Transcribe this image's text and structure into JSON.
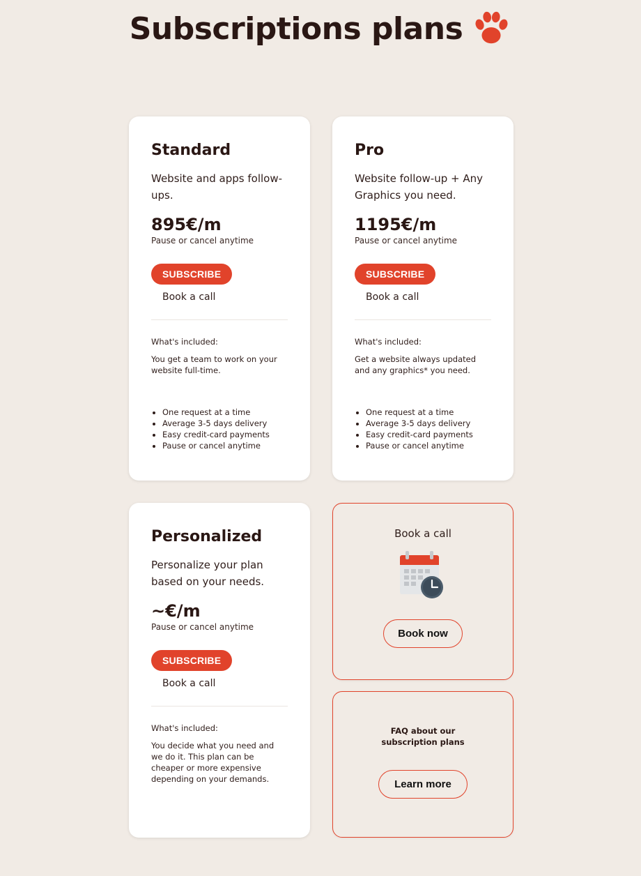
{
  "header": {
    "title": "Subscriptions plans",
    "icon": "paw-icon",
    "accent_color": "#e1432b"
  },
  "plans": [
    {
      "name": "Standard",
      "description": "Website and apps follow-ups.",
      "price": "895€/m",
      "price_note": "Pause or cancel anytime",
      "subscribe_label": "SUBSCRIBE",
      "call_label": "Book a call",
      "included_label": "What's included:",
      "included_text": "You get a team to work on your website full-time.",
      "features": [
        "One request at a time",
        "Average 3-5 days delivery",
        "Easy credit-card payments",
        "Pause or cancel anytime"
      ]
    },
    {
      "name": "Pro",
      "description": "Website follow-up + Any Graphics you need.",
      "price": "1195€/m",
      "price_note": "Pause or cancel anytime",
      "subscribe_label": "SUBSCRIBE",
      "call_label": "Book a call",
      "included_label": "What's included:",
      "included_text": "Get a website always updated and any graphics* you need.",
      "features": [
        "One request at a time",
        "Average 3-5 days delivery",
        "Easy credit-card payments",
        "Pause or cancel anytime"
      ]
    },
    {
      "name": "Personalized",
      "description": "Personalize your plan based on your needs.",
      "price": "~€/m",
      "price_note": "Pause or cancel anytime",
      "subscribe_label": "SUBSCRIBE",
      "call_label": "Book a call",
      "included_label": "What's included:",
      "included_text": "You decide what you need and we do it. This plan can be cheaper or more expensive depending on your demands."
    }
  ],
  "book_card": {
    "title": "Book a call",
    "icon": "calendar-clock-icon",
    "button_label": "Book now"
  },
  "faq_card": {
    "title": "FAQ about our subscription plans",
    "button_label": "Learn more"
  }
}
